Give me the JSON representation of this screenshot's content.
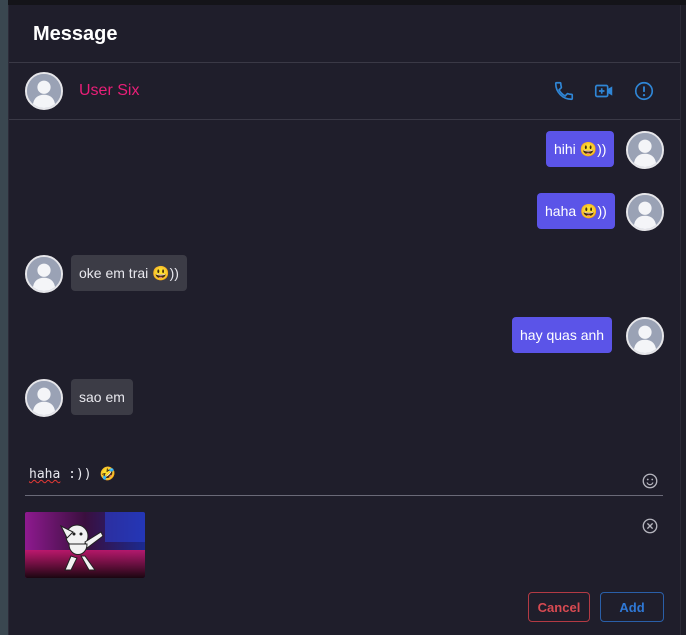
{
  "header": {
    "title": "Message"
  },
  "contact": {
    "name": "User Six",
    "name_color": "#e91e78",
    "actions": [
      {
        "icon": "phone-icon",
        "label": "Call"
      },
      {
        "icon": "video-call-icon",
        "label": "Video call"
      },
      {
        "icon": "info-alert-icon",
        "label": "Info"
      }
    ]
  },
  "messages": [
    {
      "from": "me",
      "text": "hihi 😃))"
    },
    {
      "from": "me",
      "text": "haha 😃))"
    },
    {
      "from": "them",
      "text": "oke em trai 😃))"
    },
    {
      "from": "me",
      "text": "hay quas anh"
    },
    {
      "from": "them",
      "text": "sao em"
    }
  ],
  "composer": {
    "value_word": "haha",
    "value_rest": " :)) 🤣",
    "emoji_icon": "smiley-icon",
    "attachment_icon": "remove-attachment-icon"
  },
  "buttons": {
    "cancel": "Cancel",
    "add": "Add"
  },
  "colors": {
    "sent_bubble": "#5b54e8",
    "received_bubble": "#3c3c46",
    "accent_blue": "#2f78d6",
    "cancel_red": "#d84a52"
  }
}
